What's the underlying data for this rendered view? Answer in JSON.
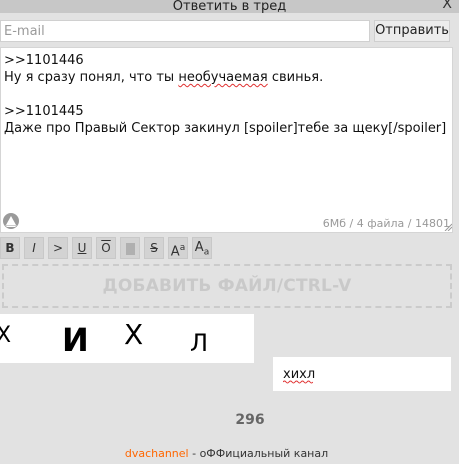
{
  "window": {
    "title": "Ответить в тред",
    "close_label": "X"
  },
  "form": {
    "email_placeholder": "E-mail",
    "send_label": "Отправить",
    "message_lines": [
      {
        "a": ">>1101446",
        "b": "",
        "c": ""
      },
      {
        "a": "Ну я сразу понял, что ты ",
        "b": "необучаемая",
        "c": " свинья."
      },
      {
        "a": ">>1101445",
        "b": "",
        "c": ""
      },
      {
        "a": "Даже про Правый Сектор закинул [spoiler]тебе за щеку[/spoiler]",
        "b": "",
        "c": ""
      }
    ],
    "file_info": "6Мб / 4 файла / 14801"
  },
  "toolbar": {
    "buttons": [
      {
        "label": "B",
        "name": "bold-button"
      },
      {
        "label": "I",
        "name": "italic-button"
      },
      {
        "label": ">",
        "name": "quote-button"
      },
      {
        "label": "U",
        "name": "underline-button"
      },
      {
        "label": "O",
        "name": "overline-button"
      },
      {
        "label": "",
        "name": "spoiler-button"
      },
      {
        "label": "S",
        "name": "strike-button"
      },
      {
        "label": "Aa",
        "name": "superscript-button"
      },
      {
        "label": "Aa",
        "name": "subscript-button"
      }
    ]
  },
  "upload": {
    "label": "ДОБАВИТЬ ФАЙЛ/CTRL-V"
  },
  "captcha": {
    "glyphs": [
      "Х",
      "И",
      "Х",
      "Л"
    ],
    "value": "хихл"
  },
  "counter": "296",
  "footer": {
    "link": "dvachannel",
    "text": " - оФФициальный канал"
  },
  "colors": {
    "accent": "#ff6600",
    "background": "#e2e2e2",
    "titlebar": "#c7c7c7"
  }
}
